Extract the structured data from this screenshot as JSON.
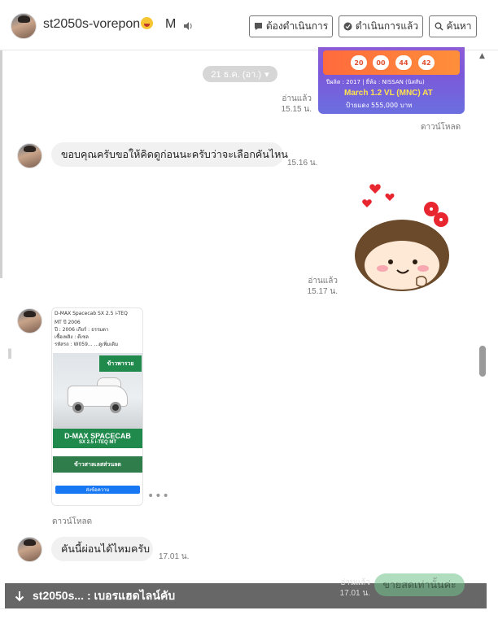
{
  "header": {
    "name": "st2050s-vorepon",
    "tag": "M",
    "buttons": {
      "todo": "ต้องดำเนินการ",
      "done": "ดำเนินการแล้ว",
      "search": "ค้นหา"
    }
  },
  "date_divider": "21 ธ.ค. (อา.)",
  "top_image": {
    "numbers": [
      "20",
      "00",
      "44",
      "42"
    ],
    "line1": "ปีผลิต : 2017 | ยี่ห้อ : NISSAN (นิสสัน)",
    "title": "March 1.2 VL (MNC) AT",
    "price": "ป้ายแดง 555,000 บาท",
    "read_label": "อ่านแล้ว",
    "time": "15.15 น.",
    "download": "ดาวน์โหลด"
  },
  "messages": [
    {
      "text": "ขอบคุณครับขอให้คิดดูก่อนนะครับว่าจะเลือกคันไหน",
      "time": "15.16 น."
    },
    {
      "text": "คันนี้ผ่อนได้ไหมครับ",
      "time": "17.01 น."
    }
  ],
  "sticker": {
    "read_label": "อ่านแล้ว",
    "time": "15.17 น."
  },
  "post_image": {
    "line1": "D-MAX Spacecab SX 2.5 i-TEQ",
    "line2": "MT ปี 2006",
    "line3": "ปี : 2006  เกียร์ : ธรรมดา",
    "line4": "เชื้อเพลิง : ดีเซล",
    "line5": "รหัสรถ : W059... ...ดูเพิ่มเติม",
    "banner_top": "ข้าวพารวย",
    "banner_main": "D-MAX SPACECAB",
    "banner_sub": "SX 2.5 i-TEQ MT",
    "promo": "ข้าวสาลเลสส่วนลด",
    "button": "ส่งข้อความ",
    "download": "ดาวน์โหลด"
  },
  "notification": {
    "text": "st2050s... : เบอรแฮดไลน์คับ"
  },
  "pending_reply": {
    "text": "ขายสดเท่านั้นค่ะ",
    "read_label": "อ่านแล้ว",
    "time": "17.01 น."
  },
  "colors": {
    "bubble_bg": "#f1f1f1",
    "notify_bg": "#5a5a5a",
    "reply_green": "#6fc28a",
    "link_blue": "#1877f2"
  }
}
